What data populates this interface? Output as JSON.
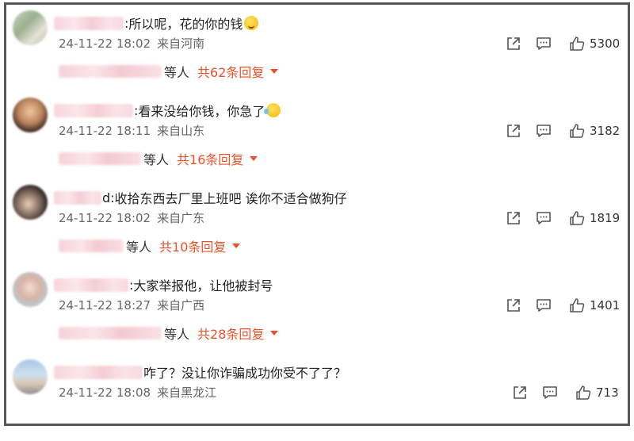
{
  "comments": [
    {
      "separator": ":",
      "text": "所以呢，花的你的钱",
      "emoji": "thinking-face-emoji",
      "time": "24-11-22 18:02",
      "location": "来自河南",
      "likes": "5300",
      "reply_etc": "等人",
      "reply_total": "共62条回复"
    },
    {
      "separator": ":",
      "text": "看来没给你钱，你急了",
      "emoji": "laughing-tears-emoji",
      "time": "24-11-22 18:11",
      "location": "来自山东",
      "likes": "3182",
      "reply_etc": "等人",
      "reply_total": "共16条回复"
    },
    {
      "separator": "d:",
      "text": "收拾东西去厂里上班吧 诶你不适合做狗仔",
      "emoji": "",
      "time": "24-11-22 18:02",
      "location": "来自广东",
      "likes": "1819",
      "reply_etc": "等人",
      "reply_total": "共10条回复"
    },
    {
      "separator": ":",
      "text": "大家举报他，让他被封号",
      "emoji": "",
      "time": "24-11-22 18:27",
      "location": "来自广西",
      "likes": "1401",
      "reply_etc": "等人",
      "reply_total": "共28条回复"
    },
    {
      "separator": "",
      "text": "咋了？没让你诈骗成功你受不了了？",
      "emoji": "",
      "time": "24-11-22 18:08",
      "location": "来自黑龙江",
      "likes": "713",
      "reply_etc": "",
      "reply_total": ""
    }
  ],
  "colors": {
    "accent": "#e8532b",
    "meta_text": "#666666",
    "frame_border": "#555555"
  },
  "icons": {
    "share": "share-icon",
    "comment": "comment-icon",
    "like": "thumbs-up-icon"
  }
}
